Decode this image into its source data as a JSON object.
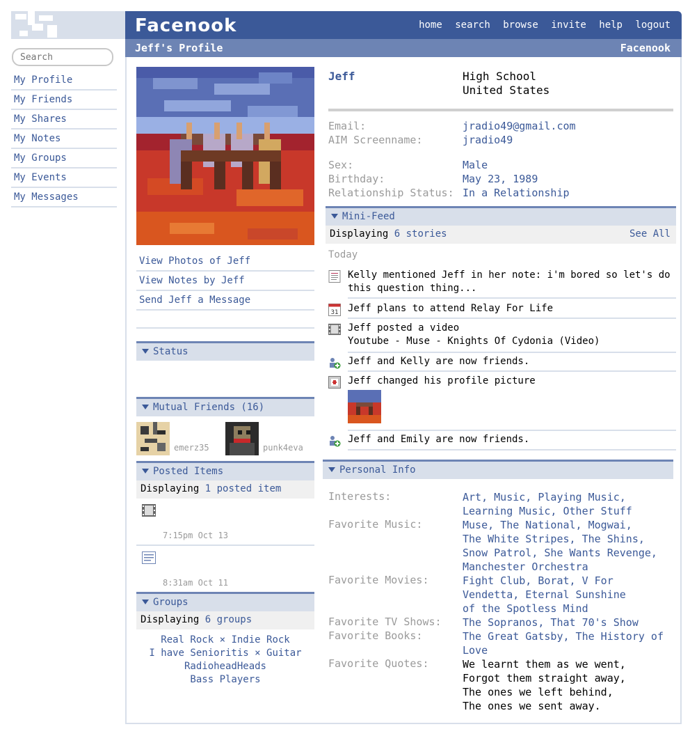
{
  "app": {
    "brand": "Facenook"
  },
  "search": {
    "placeholder": "Search"
  },
  "left_nav": [
    {
      "label": "My Profile"
    },
    {
      "label": "My Friends"
    },
    {
      "label": "My Shares"
    },
    {
      "label": "My Notes"
    },
    {
      "label": "My Groups"
    },
    {
      "label": "My Events"
    },
    {
      "label": "My Messages"
    }
  ],
  "top_nav": [
    "home",
    "search",
    "browse",
    "invite",
    "help",
    "logout"
  ],
  "subheader": {
    "title": "Jeff's Profile",
    "brand": "Facenook"
  },
  "profile_actions": [
    "View Photos of Jeff",
    "View Notes by Jeff",
    "Send Jeff a Message"
  ],
  "status": {
    "heading": "Status"
  },
  "mutual_friends": {
    "heading": "Mutual Friends (16)",
    "friends": [
      {
        "name": "emerz35"
      },
      {
        "name": "punk4eva"
      }
    ]
  },
  "posted_items": {
    "heading": "Posted Items",
    "display_prefix": "Displaying",
    "display_link": "1 posted item",
    "items": [
      {
        "icon": "film-icon",
        "time": "7:15pm Oct 13"
      },
      {
        "icon": "note-icon",
        "time": "8:31am Oct 11"
      }
    ]
  },
  "groups": {
    "heading": "Groups",
    "display_prefix": "Displaying",
    "display_link": "6 groups",
    "lines": [
      [
        "Real Rock",
        "Indie Rock"
      ],
      [
        "I have Senioritis",
        "Guitar"
      ],
      [
        "RadioheadHeads"
      ],
      [
        "Bass Players"
      ]
    ],
    "separator": "×"
  },
  "info": {
    "name": "Jeff",
    "network_line1": "High School",
    "network_line2": "United States",
    "email_label": "Email:",
    "email": "jradio49@gmail.com",
    "aim_label": "AIM Screenname:",
    "aim": "jradio49",
    "sex_label": "Sex:",
    "sex": "Male",
    "birthday_label": "Birthday:",
    "birthday": "May 23, 1989",
    "relationship_label": "Relationship Status:",
    "relationship": "In a Relationship"
  },
  "minifeed": {
    "heading": "Mini-Feed",
    "display_prefix": "Displaying",
    "display_link": "6 stories",
    "see_all": "See All",
    "day": "Today",
    "items": [
      {
        "icon": "note-icon",
        "text": "Kelly mentioned Jeff in her note: i'm bored so let's do this question thing..."
      },
      {
        "icon": "calendar-icon",
        "text": "Jeff plans to attend Relay For Life",
        "icon_text": "31"
      },
      {
        "icon": "film-icon",
        "text": "Jeff posted a video",
        "text2": "Youtube - Muse - Knights Of Cydonia (Video)"
      },
      {
        "icon": "friends-icon",
        "text": "Jeff and Kelly are now friends."
      },
      {
        "icon": "profile-picture-icon",
        "text": "Jeff changed his profile picture"
      },
      {
        "icon": "friends-icon",
        "text": "Jeff and Emily are now friends."
      }
    ]
  },
  "personal_info": {
    "heading": "Personal Info",
    "interests_label": "Interests:",
    "interests": "Art, Music, Playing Music, Learning Music, Other Stuff",
    "music_label": "Favorite Music:",
    "music": [
      "Muse, The National, Mogwai,",
      "The White Stripes, The Shins,",
      "Snow Patrol, She Wants Revenge,",
      "Manchester Orchestra"
    ],
    "movies_label": "Favorite Movies:",
    "movies": [
      "Fight Club, Borat, V For",
      "Vendetta, Eternal Sunshine",
      "of the Spotless Mind"
    ],
    "tv_label": "Favorite TV Shows:",
    "tv": "The Sopranos, That 70's Show",
    "books_label": "Favorite Books:",
    "books": [
      "The Great Gatsby, The History of",
      "Love"
    ],
    "quotes_label": "Favorite Quotes:",
    "quotes": [
      "We learnt them as we went,",
      "Forgot them straight away,",
      "The ones we left behind,",
      "The ones we sent away."
    ]
  },
  "colors": {
    "brand_blue": "#3b5998",
    "sub_blue": "#6d84b4",
    "light_blue": "#d8dfea",
    "gray_text": "#9a9a9a"
  }
}
